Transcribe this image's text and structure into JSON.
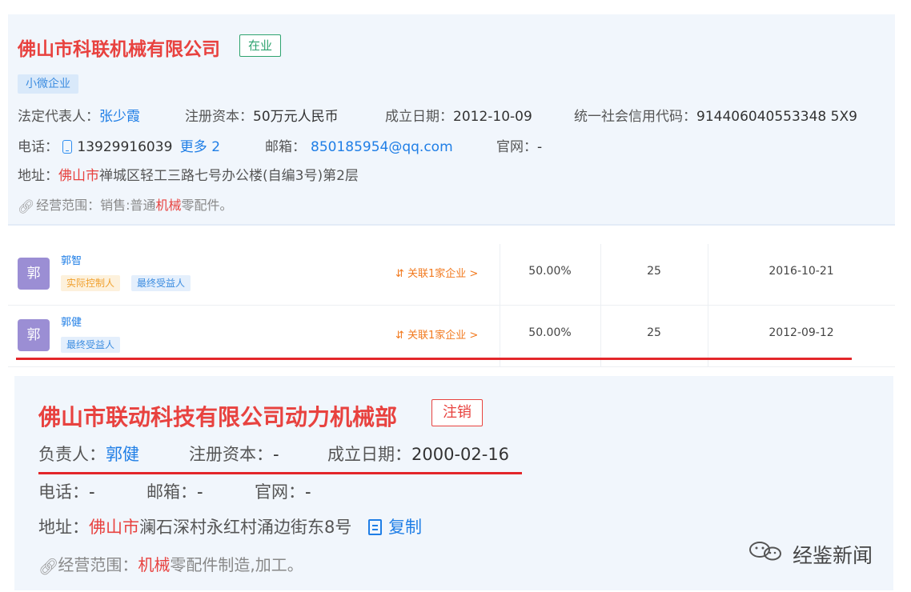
{
  "company1": {
    "name": "佛山市科联机械有限公司",
    "status": "在业",
    "tag": "小微企业",
    "legal_rep_label": "法定代表人：",
    "legal_rep": "张少霞",
    "capital_label": "注册资本：",
    "capital": "50万元人民币",
    "founded_label": "成立日期：",
    "founded": "2012-10-09",
    "credit_label": "统一社会信用代码：",
    "credit": "914406040553348 5X9",
    "phone_label": "电话：",
    "phone": "13929916039",
    "more": "更多 2",
    "email_label": "邮箱：",
    "email": "850185954@qq.com",
    "website_label": "官网：",
    "website": "-",
    "address_label": "地址：",
    "address_city": "佛山市",
    "address_rest": "禅城区轻工三路七号办公楼(自编3号)第2层",
    "scope_label": "经营范围：",
    "scope_pre": "销售:普通",
    "scope_kw": "机械",
    "scope_post": "零配件。"
  },
  "shareholders": [
    {
      "avatar": "郭",
      "name": "郭智",
      "tags": [
        "实际控制人",
        "最终受益人"
      ],
      "related": "关联1家企业 >",
      "ratio": "50.00%",
      "amount": "25",
      "date": "2016-10-21"
    },
    {
      "avatar": "郭",
      "name": "郭健",
      "tags": [
        "最终受益人"
      ],
      "related": "关联1家企业 >",
      "ratio": "50.00%",
      "amount": "25",
      "date": "2012-09-12"
    }
  ],
  "company2": {
    "name": "佛山市联动科技有限公司动力机械部",
    "status": "注销",
    "head_label": "负责人：",
    "head": "郭健",
    "capital_label": "注册资本：",
    "capital": "-",
    "founded_label": "成立日期：",
    "founded": "2000-02-16",
    "phone_label": "电话：",
    "phone": "-",
    "email_label": "邮箱：",
    "email": "-",
    "website_label": "官网：",
    "website": "-",
    "address_label": "地址：",
    "address_city": "佛山市",
    "address_rest": "澜石深村永红村涌边街东8号",
    "copy": "复制",
    "scope_label": "经营范围：",
    "scope_kw": "机械",
    "scope_post": "零配件制造,加工。"
  },
  "watermark": "经鉴新闻",
  "colors": {
    "brand_red": "#e8423f",
    "link_blue": "#1f7ee6",
    "active_green": "#2ea36f"
  }
}
